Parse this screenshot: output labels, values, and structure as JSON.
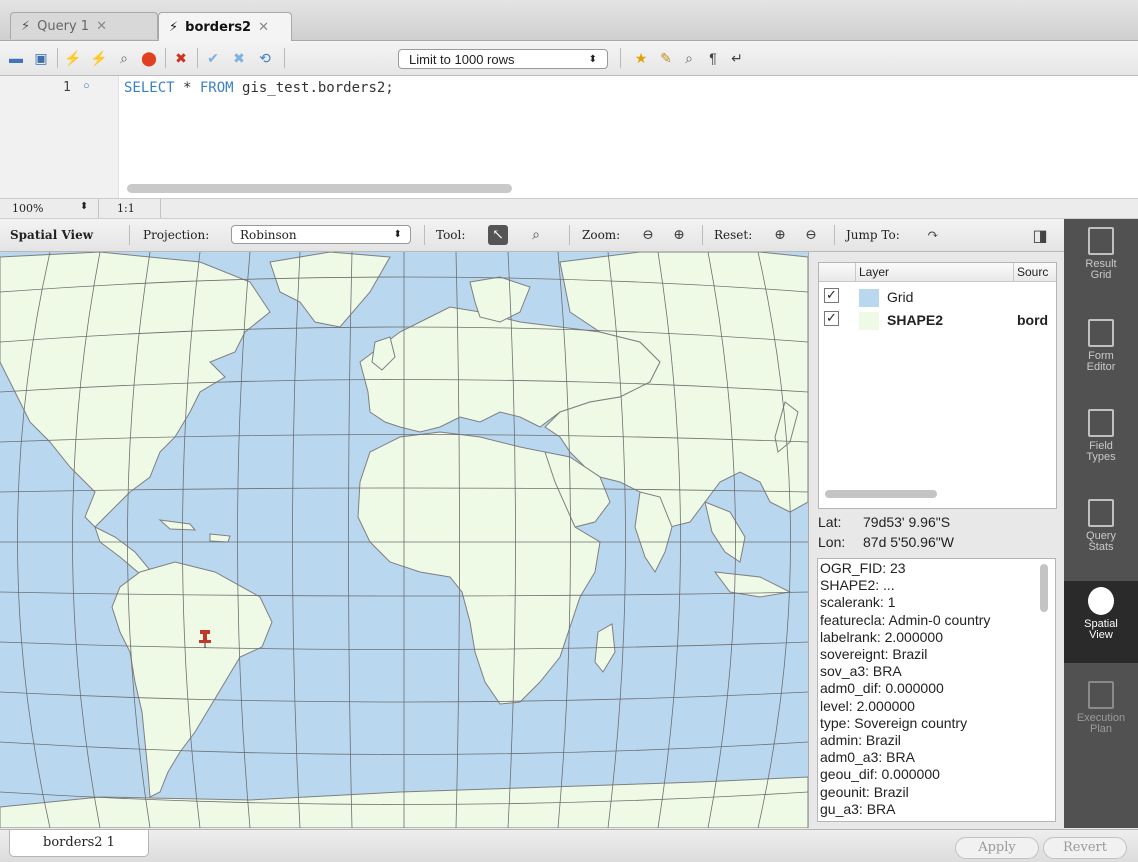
{
  "tabs": [
    {
      "label": "Query 1",
      "active": false
    },
    {
      "label": "borders2",
      "active": true
    }
  ],
  "toolbar": {
    "limit_value": "Limit to 1000 rows"
  },
  "editor": {
    "line_number": "1",
    "sql_keyword1": "SELECT",
    "sql_star": " * ",
    "sql_keyword2": "FROM",
    "sql_rest": " gis_test.borders2;"
  },
  "zoom_row": {
    "zoom": "100%",
    "ratio": "1:1"
  },
  "spatial_toolbar": {
    "title": "Spatial View",
    "projection_label": "Projection:",
    "projection_value": "Robinson",
    "tool_label": "Tool:",
    "zoom_label": "Zoom:",
    "reset_label": "Reset:",
    "jump_label": "Jump To:"
  },
  "layers": {
    "col_layer": "Layer",
    "col_source": "Sourc",
    "rows": [
      {
        "name": "Grid",
        "source": "",
        "checked": true,
        "color": "#b9d7ef"
      },
      {
        "name": "SHAPE2",
        "source": "bord",
        "checked": true,
        "color": "#eef9e6"
      }
    ]
  },
  "coords": {
    "lat_label": "Lat:",
    "lat": "79d53' 9.96\"S",
    "lon_label": "Lon:",
    "lon": "87d 5'50.96\"W"
  },
  "info_lines": [
    "OGR_FID: 23",
    "SHAPE2: ...",
    "scalerank: 1",
    "featurecla: Admin-0 country",
    "labelrank: 2.000000",
    "sovereignt: Brazil",
    "sov_a3: BRA",
    "adm0_dif: 0.000000",
    "level: 2.000000",
    "type: Sovereign country",
    "admin: Brazil",
    "adm0_a3: BRA",
    "geou_dif: 0.000000",
    "geounit: Brazil",
    "gu_a3: BRA"
  ],
  "sidebar": [
    {
      "line1": "Result",
      "line2": "Grid",
      "active": false
    },
    {
      "line1": "Form",
      "line2": "Editor",
      "active": false
    },
    {
      "line1": "Field",
      "line2": "Types",
      "active": false
    },
    {
      "line1": "Query",
      "line2": "Stats",
      "active": false
    },
    {
      "line1": "Spatial",
      "line2": "View",
      "active": true
    },
    {
      "line1": "Execution",
      "line2": "Plan",
      "active": false
    }
  ],
  "bottom": {
    "result_tab": "borders2 1",
    "apply": "Apply",
    "revert": "Revert"
  },
  "colors": {
    "ocean": "#b9d7ef",
    "land": "#eef9e6",
    "border": "#7f7f7f",
    "grid": "#6f6f6f",
    "pin": "#c0392b"
  }
}
